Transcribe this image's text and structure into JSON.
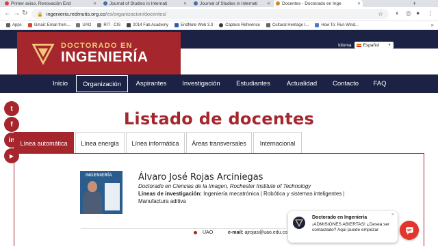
{
  "browser": {
    "tabs": [
      {
        "title": "Primer aviso, Renovación End",
        "favicon_color": "#d44638"
      },
      {
        "title": "Journal of Studies in Internati",
        "favicon_color": "#4a6fa5"
      },
      {
        "title": "Journal of Studies in Internati",
        "favicon_color": "#4a6fa5"
      },
      {
        "title": "Docentes - Doctorado en Inge",
        "favicon_color": "#c98b2b"
      }
    ],
    "new_tab": "+",
    "url_host": "ingenieria.redmutis.org.co",
    "url_path": "/es/organizacion/docentes/",
    "bookmarks": [
      "Apps",
      "Gmail: Email from...",
      "UAO",
      "RIT - CIS",
      "2014 Fab Academy",
      "EndNote Web 3.3",
      "Capture Reference",
      "Cultural Heritage I...",
      "How To: Run Wind..."
    ],
    "bookmarks_more": "»"
  },
  "site": {
    "logo_line1": "DOCTORADO EN",
    "logo_line2": "INGENIERÍA",
    "language_label": "Idioma",
    "language_value": "Español",
    "nav": [
      "Inicio",
      "Organización",
      "Aspirantes",
      "Investigación",
      "Estudiantes",
      "Actualidad",
      "Contacto",
      "FAQ"
    ],
    "nav_active": "Organización",
    "social": [
      {
        "name": "twitter",
        "glyph": "t"
      },
      {
        "name": "facebook",
        "glyph": "f"
      },
      {
        "name": "linkedin",
        "glyph": "in"
      },
      {
        "name": "youtube",
        "glyph": "▶"
      }
    ]
  },
  "page": {
    "title": "Listado de docentes",
    "tabs": [
      "Línea automática",
      "Línea energía",
      "Línea informática",
      "Áreas transversales",
      "Internacional"
    ],
    "active_tab": "Línea automática"
  },
  "teacher": {
    "photo_label": "INGENIERÍA",
    "name": "Álvaro José Rojas Arciniegas",
    "degree": "Doctorado en Ciencias de la Imagen, Rochester Institute of Technology",
    "research_label": "Líneas de investigación:",
    "research_text": " Ingeniería mecatrónica | Robótica y sistemas inteligentes | Manufactura aditiva",
    "institution": "UAO",
    "email_label": "e-mail:",
    "email": " ajrojas@uao.edu.co"
  },
  "chat": {
    "title": "Doctorado en Ingeniería",
    "message": "¡ADMISIONES ABIERTAS! ¿Desea ser contactado? Aquí puede empezar",
    "close": "×"
  },
  "colors": {
    "brand_red": "#a5262c",
    "navy": "#1b2243",
    "gold": "#f2c879",
    "chat_red": "#e2352c"
  }
}
